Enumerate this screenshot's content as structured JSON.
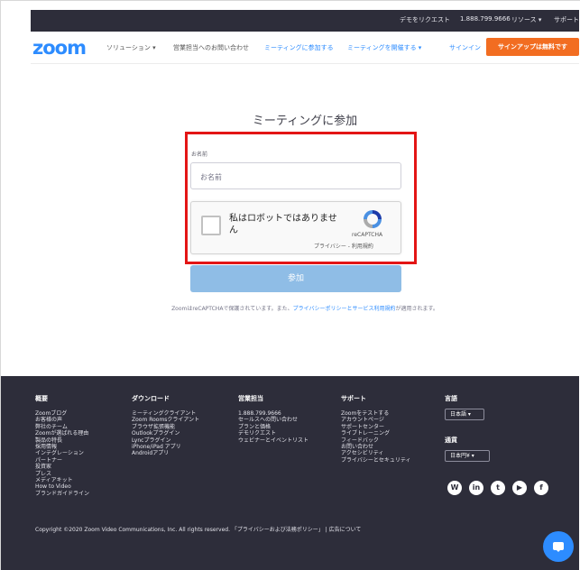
{
  "topbar": {
    "request_demo": "デモをリクエスト",
    "phone": "1.888.799.9666",
    "resources": "リソース ▾",
    "support": "サポート"
  },
  "nav": {
    "logo": "zoom",
    "solutions": "ソリューション ▾",
    "contact_sales": "営業担当へのお問い合わせ",
    "join_meeting": "ミーティングに参加する",
    "host_meeting": "ミーティングを開催する ▾",
    "sign_in": "サインイン",
    "sign_up": "サインアップは無料です"
  },
  "main": {
    "title": "ミーティングに参加",
    "name_label": "お名前",
    "name_placeholder": "お名前",
    "captcha_text": "私はロボットではありません",
    "recaptcha_name": "reCAPTCHA",
    "recaptcha_links": "プライバシー - 利用規約",
    "join_button": "参加",
    "notice_before": "ZoomはreCAPTCHAで保護されています。また、",
    "notice_link": "プライバシーポリシーとサービス利用規約",
    "notice_after": "が適用されます。"
  },
  "footer": {
    "about": {
      "heading": "概要",
      "items": [
        "Zoomブログ",
        "お客様の声",
        "弊社のチーム",
        "Zoomが選ばれる理由",
        "製品の特長",
        "採用情報",
        "インテグレーション",
        "パートナー",
        "投資家",
        "プレス",
        "メディアキット",
        "How to Video",
        "ブランドガイドライン"
      ]
    },
    "download": {
      "heading": "ダウンロード",
      "items": [
        "ミーティングクライアント",
        "Zoom Roomsクライアント",
        "ブラウザ拡張機能",
        "Outlookプラグイン",
        "Lyncプラグイン",
        "iPhone/iPad アプリ",
        "Androidアプリ"
      ]
    },
    "sales": {
      "heading": "営業担当",
      "items": [
        "1.888.799.9666",
        "セールスへの問い合わせ",
        "プランと価格",
        "デモリクエスト",
        "ウェビナーとイベントリスト"
      ]
    },
    "support": {
      "heading": "サポート",
      "items": [
        "Zoomをテストする",
        "アカウントページ",
        "サポートセンター",
        "ライブトレーニング",
        "フィードバック",
        "お問い合わせ",
        "アクセシビリティ",
        "プライバシーとセキュリティ"
      ]
    },
    "language": {
      "heading": "言語",
      "selected": "日本語 ▾"
    },
    "currency": {
      "heading": "通貨",
      "selected": "日本円¥ ▾"
    },
    "social": [
      "W",
      "in",
      "t",
      "▶",
      "f"
    ],
    "copyright": "Copyright ©2020 Zoom Video Communications, Inc. All rights reserved. 「プライバシーおよび法務ポリシー」 | 広告について"
  }
}
